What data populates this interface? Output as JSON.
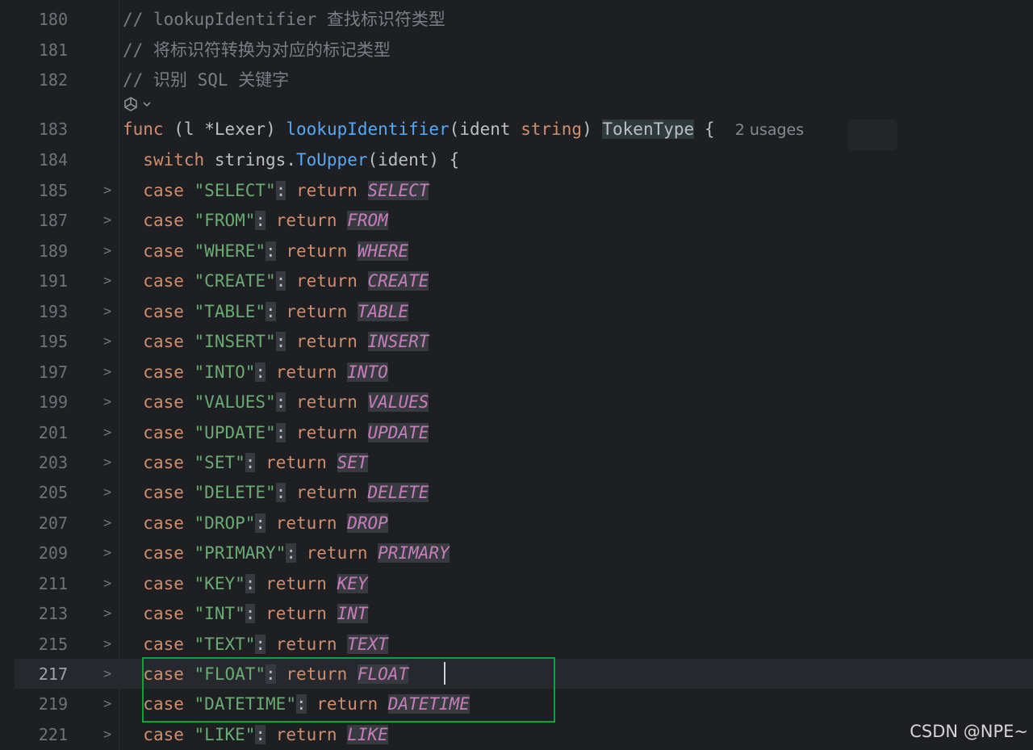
{
  "editor": {
    "header_lines": [
      {
        "num": "180",
        "comment": "// lookupIdentifier 查找标识符类型"
      },
      {
        "num": "181",
        "comment": "// 将标识符转换为对应的标记类型"
      },
      {
        "num": "182",
        "comment": "// 识别 SQL 关键字"
      }
    ],
    "func_line": {
      "num": "183",
      "kw_func": "func",
      "recv_open": "(",
      "recv_name": "l",
      "recv_type": "*Lexer",
      "recv_close": ")",
      "name": "lookupIdentifier",
      "param_open": "(",
      "param_name": "ident",
      "param_type": "string",
      "param_close": ")",
      "ret_type": "TokenType",
      "brace": "{",
      "usages": "2 usages"
    },
    "switch_line": {
      "num": "184",
      "kw_switch": "switch",
      "pkg": "strings",
      "dot": ".",
      "method": "ToUpper",
      "args": "(ident)",
      "brace": "{"
    },
    "case_lines": [
      {
        "num": "185",
        "key": "\"SELECT\"",
        "const": "SELECT"
      },
      {
        "num": "187",
        "key": "\"FROM\"",
        "const": "FROM"
      },
      {
        "num": "189",
        "key": "\"WHERE\"",
        "const": "WHERE"
      },
      {
        "num": "191",
        "key": "\"CREATE\"",
        "const": "CREATE"
      },
      {
        "num": "193",
        "key": "\"TABLE\"",
        "const": "TABLE"
      },
      {
        "num": "195",
        "key": "\"INSERT\"",
        "const": "INSERT"
      },
      {
        "num": "197",
        "key": "\"INTO\"",
        "const": "INTO"
      },
      {
        "num": "199",
        "key": "\"VALUES\"",
        "const": "VALUES"
      },
      {
        "num": "201",
        "key": "\"UPDATE\"",
        "const": "UPDATE"
      },
      {
        "num": "203",
        "key": "\"SET\"",
        "const": "SET"
      },
      {
        "num": "205",
        "key": "\"DELETE\"",
        "const": "DELETE"
      },
      {
        "num": "207",
        "key": "\"DROP\"",
        "const": "DROP"
      },
      {
        "num": "209",
        "key": "\"PRIMARY\"",
        "const": "PRIMARY"
      },
      {
        "num": "211",
        "key": "\"KEY\"",
        "const": "KEY"
      },
      {
        "num": "213",
        "key": "\"INT\"",
        "const": "INT"
      },
      {
        "num": "215",
        "key": "\"TEXT\"",
        "const": "TEXT"
      },
      {
        "num": "217",
        "key": "\"FLOAT\"",
        "const": "FLOAT"
      },
      {
        "num": "219",
        "key": "\"DATETIME\"",
        "const": "DATETIME"
      },
      {
        "num": "221",
        "key": "\"LIKE\"",
        "const": "LIKE"
      }
    ],
    "kw_case": "case",
    "colon": ":",
    "kw_return": "return",
    "fold_glyph": ">",
    "current_line": "217",
    "highlighted_lines": [
      "217",
      "219"
    ]
  },
  "icons": {
    "ai_assistant": "ai-assistant-icon",
    "fold": "chevron-right-icon"
  },
  "watermark": "CSDN @NPE~",
  "colors": {
    "background": "#1e1f22",
    "keyword": "#cf8e6d",
    "string": "#6aab73",
    "function": "#56a8f5",
    "constant": "#c77dbb",
    "comment": "#7a7e85",
    "highlight_box": "#0aa53a"
  }
}
